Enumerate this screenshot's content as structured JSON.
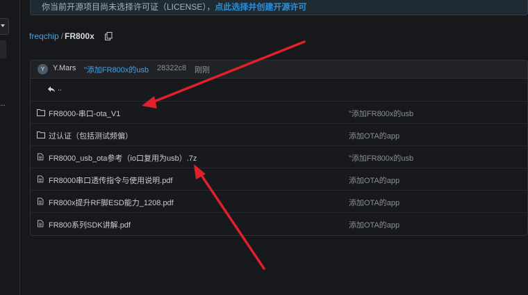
{
  "notice": {
    "text": "你当前开源项目尚未选择许可证（LICENSE），",
    "link": "点此选择并创建开源许可"
  },
  "breadcrumb": {
    "owner": "freqchip",
    "separator": "/",
    "repo": "FR800x"
  },
  "commit": {
    "avatar_letter": "Y",
    "author": "Y.Mars",
    "message": "\"添加FR800x的usb",
    "hash": "28322c8",
    "time": "刚刚"
  },
  "back_row": {
    "label": ".."
  },
  "files": [
    {
      "name": "FR8000-串口-ota_V1",
      "type": "folder",
      "message": "\"添加FR800x的usb"
    },
    {
      "name": "过认证（包括测试频偏）",
      "type": "folder",
      "message": "添加OTA的app"
    },
    {
      "name": "FR8000_usb_ota参考（io口复用为usb）.7z",
      "type": "file",
      "message": "\"添加FR800x的usb"
    },
    {
      "name": "FR8000串口透传指令与使用说明.pdf",
      "type": "file",
      "message": "添加OTA的app"
    },
    {
      "name": "FR800x提升RF脚ESD能力_1208.pdf",
      "type": "file",
      "message": "添加OTA的app"
    },
    {
      "name": "FR800系列SDK讲解.pdf",
      "type": "file",
      "message": "添加OTA的app"
    }
  ],
  "icons": {
    "copy": "copy-icon",
    "folder": "folder-icon",
    "file": "file-icon",
    "back": "back-arrow-icon"
  },
  "colors": {
    "background": "#17181b",
    "link": "#4aa3e3",
    "annotation_arrow": "#e0202a"
  }
}
